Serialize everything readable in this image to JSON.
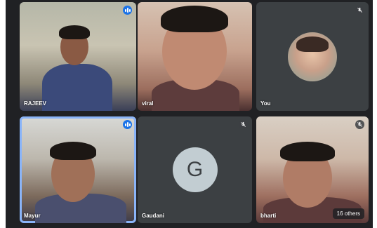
{
  "participants": [
    {
      "name": "RAJEEV",
      "audio": "active"
    },
    {
      "name": "viral",
      "audio": "none"
    },
    {
      "name": "You",
      "audio": "muted",
      "avatar": "photo"
    },
    {
      "name": "Mayur",
      "audio": "active"
    },
    {
      "name": "Gaudani",
      "audio": "muted",
      "avatar_letter": "G"
    },
    {
      "name": "bharti",
      "audio": "muted"
    }
  ],
  "overflow_label": "16 others",
  "colors": {
    "background": "#202124",
    "tile": "#3c4043",
    "active_speaker": "#1a73e8",
    "highlight_border": "#8ab4f8"
  },
  "icons": [
    "audio-level-icon",
    "mic-off-icon"
  ]
}
